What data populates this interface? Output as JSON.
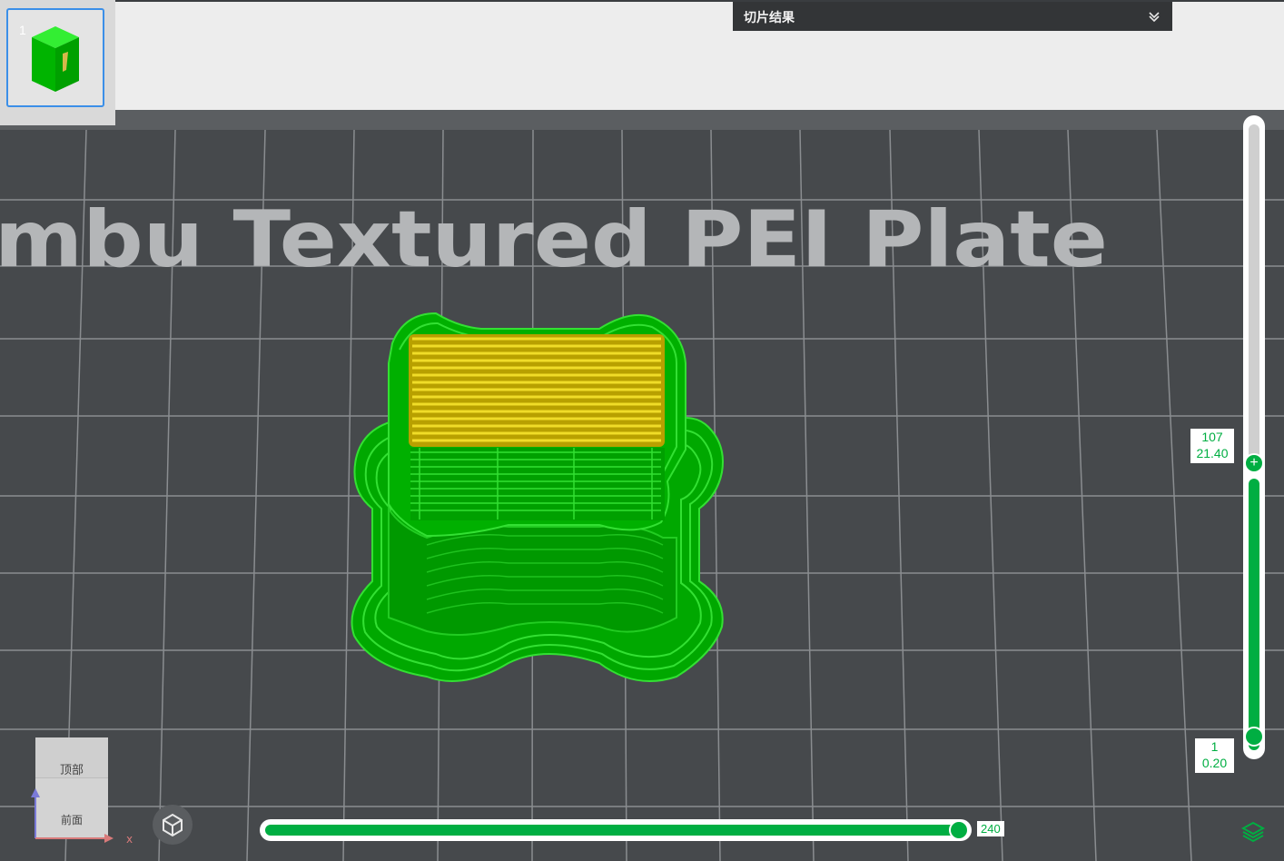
{
  "plate_list": {
    "plates": [
      {
        "index": "1",
        "selected": true
      }
    ]
  },
  "slice_result_panel": {
    "title": "切片结果",
    "collapse_icon": "double-chevron-down-icon"
  },
  "viewport": {
    "bed_label": "mbu Textured PEI Plate",
    "model_colors": {
      "wall": "#00c200",
      "top_surface": "#e6d21e"
    }
  },
  "view_cube": {
    "top_label": "顶部",
    "front_label": "前面",
    "axis_x_label": "x"
  },
  "reset_view_button": {
    "icon": "view-cube-icon"
  },
  "move_slider": {
    "value_label": "240",
    "fill_fraction": 1.0
  },
  "layer_slider": {
    "top": {
      "layer": "107",
      "height": "21.40"
    },
    "bottom": {
      "layer": "1",
      "height": "0.20"
    },
    "top_fraction": 0.434,
    "thumb_icon": "plus-icon"
  },
  "layers_button": {
    "icon": "layers-icon"
  },
  "colors": {
    "accent": "#00ae42",
    "selection": "#3b8fe8",
    "background": "#46494c"
  }
}
